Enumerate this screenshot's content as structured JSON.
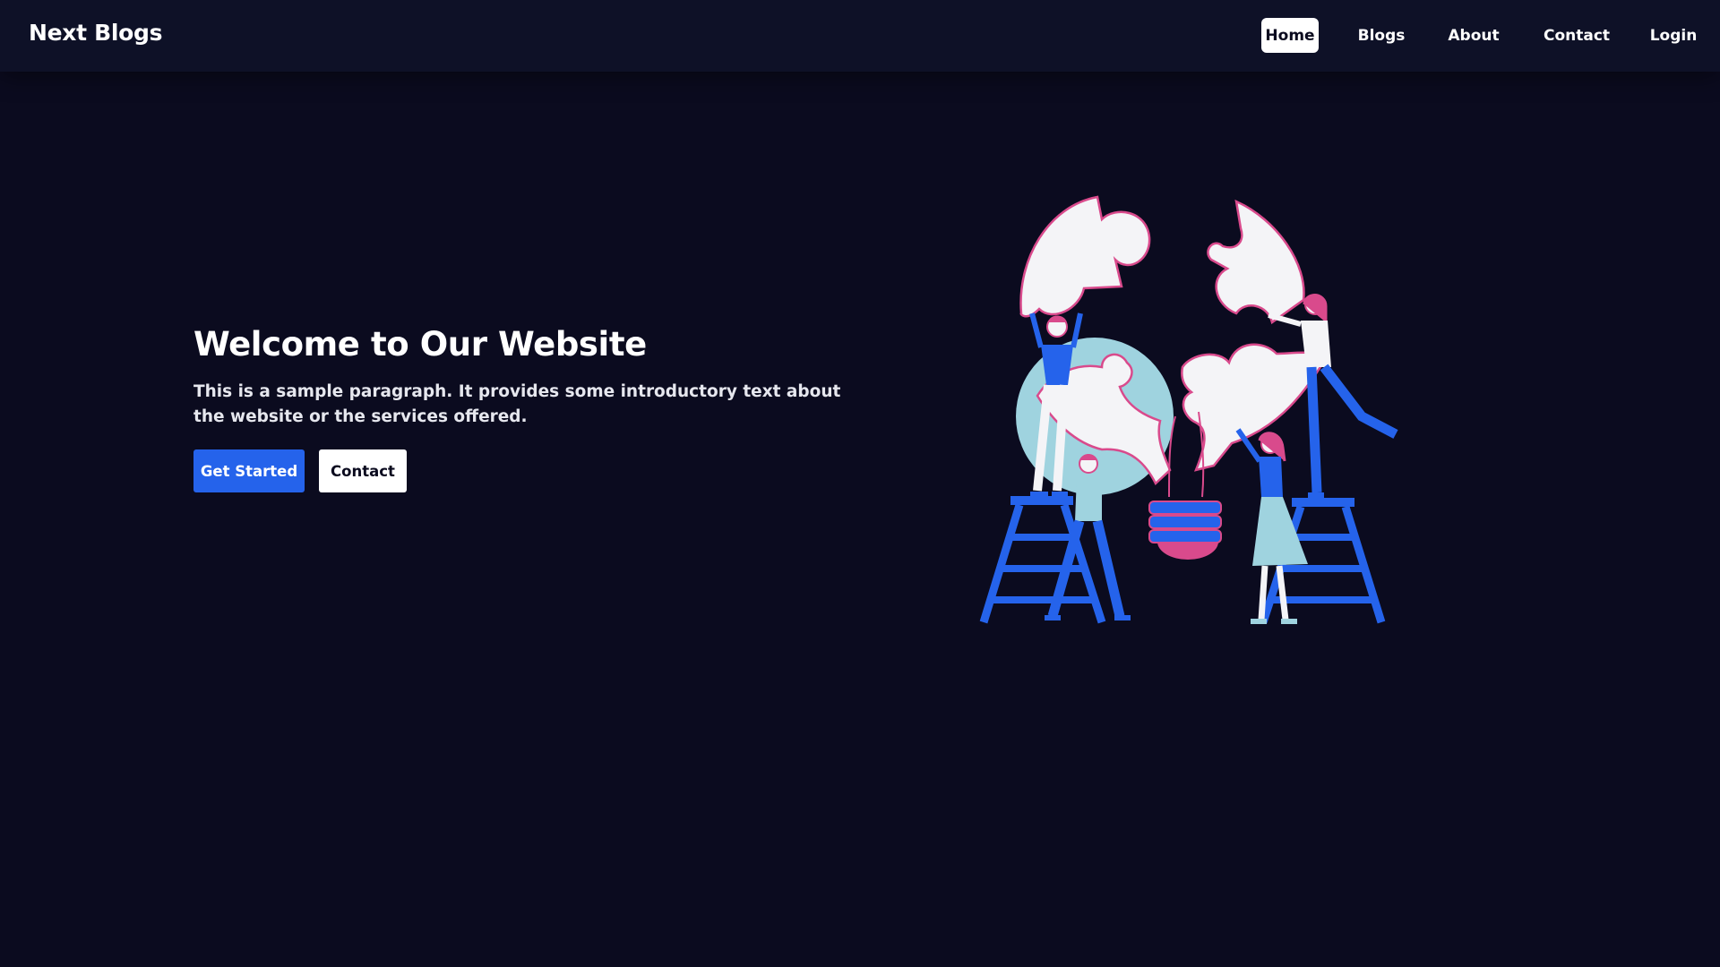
{
  "navbar": {
    "brand": "Next Blogs",
    "links": [
      {
        "label": "Home",
        "active": true
      },
      {
        "label": "Blogs",
        "active": false
      },
      {
        "label": "About",
        "active": false
      },
      {
        "label": "Contact",
        "active": false
      },
      {
        "label": "Login",
        "active": false
      }
    ]
  },
  "hero": {
    "title": "Welcome to Our Website",
    "paragraph": "This is a sample paragraph. It provides some introductory text about the website or the services offered.",
    "primary_button": "Get Started",
    "secondary_button": "Contact",
    "illustration": "puzzle-team-illustration"
  },
  "colors": {
    "background": "#0b0b1f",
    "navbar": "#0e1127",
    "accent_blue": "#2563eb",
    "illustration_pink": "#d94a8c",
    "illustration_light_blue": "#9fd3df"
  }
}
